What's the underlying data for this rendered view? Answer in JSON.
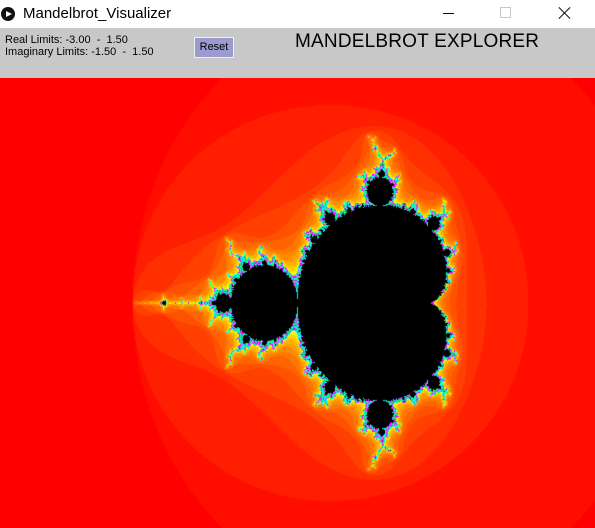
{
  "window": {
    "title": "Mandelbrot_Visualizer",
    "icon": "play-circle-icon"
  },
  "controls": {
    "real_limits": "Real Limits: -3.00  -  1.50",
    "imaginary_limits": "Imaginary Limits: -1.50  -  1.50",
    "reset_label": "Reset"
  },
  "header": {
    "title": "MANDELBROT EXPLORER"
  },
  "fractal": {
    "real_min": -3.0,
    "real_max": 1.5,
    "imag_min": -1.5,
    "imag_max": 1.5,
    "max_iterations": 120,
    "colors": {
      "background": "#ff0000",
      "near_edge": "#ffff00",
      "edge_band": [
        "#00ff80",
        "#00ffff",
        "#ff00ff"
      ],
      "interior": "#000000",
      "panel": "#c8c8c8",
      "reset_button": "#9b9bcf"
    }
  }
}
